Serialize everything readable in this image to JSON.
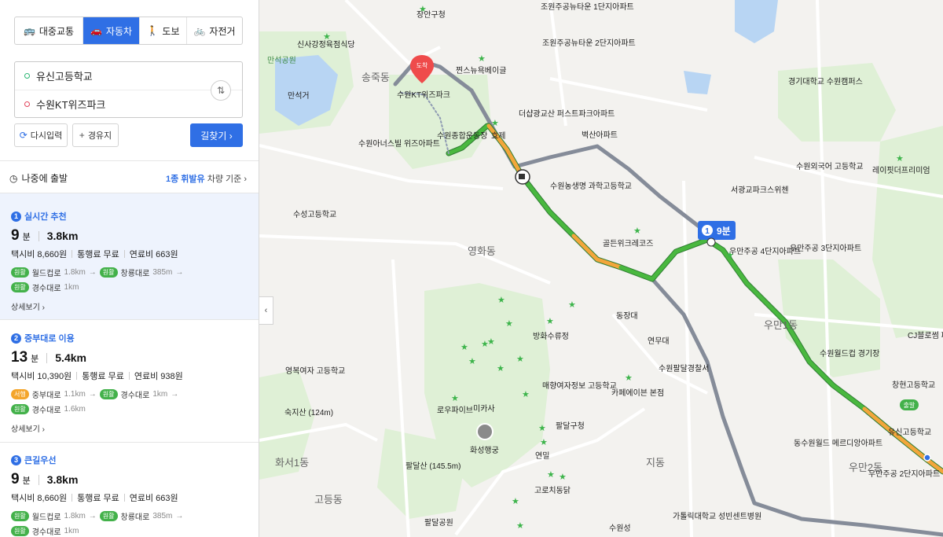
{
  "tabs": [
    {
      "label": "대중교통",
      "icon": "bus-icon",
      "glyph": "🚌",
      "active": false
    },
    {
      "label": "자동차",
      "icon": "car-icon",
      "glyph": "🚗",
      "active": true
    },
    {
      "label": "도보",
      "icon": "walk-icon",
      "glyph": "🚶",
      "active": false
    },
    {
      "label": "자전거",
      "icon": "bicycle-icon",
      "glyph": "🚲",
      "active": false
    }
  ],
  "route": {
    "origin": "유신고등학교",
    "destination": "수원KT위즈파크",
    "swap_glyph": "⇅"
  },
  "buttons": {
    "reset": "다시입력",
    "waypoint": "경유지",
    "search": "길찾기 ›"
  },
  "depart": {
    "label": "나중에 출발",
    "fuel_highlight": "1종 휘발유",
    "fuel_suffix": "차량 기준 ›"
  },
  "routes": [
    {
      "num": "1",
      "title": "실시간 추천",
      "time": "9",
      "time_unit": "분",
      "distance": "3.8km",
      "taxi": "택시비 8,660원",
      "toll": "통행료 무료",
      "fuel": "연료비 663원",
      "roads_line1": [
        {
          "badge": "원활",
          "name": "월드컵로",
          "dist": "1.8km"
        },
        {
          "badge": "원활",
          "name": "창룡대로",
          "dist": "385m"
        }
      ],
      "roads_line2": [
        {
          "badge": "원활",
          "name": "경수대로",
          "dist": "1km"
        }
      ],
      "detail": "상세보기 ›"
    },
    {
      "num": "2",
      "title": "중부대로 이용",
      "time": "13",
      "time_unit": "분",
      "distance": "5.4km",
      "taxi": "택시비 10,390원",
      "toll": "통행료 무료",
      "fuel": "연료비 938원",
      "roads_line1": [
        {
          "badge": "서행",
          "name": "중부대로",
          "dist": "1.1km"
        },
        {
          "badge": "원활",
          "name": "경수대로",
          "dist": "1km"
        }
      ],
      "roads_line2": [
        {
          "badge": "원활",
          "name": "경수대로",
          "dist": "1.6km"
        }
      ],
      "detail": "상세보기 ›"
    },
    {
      "num": "3",
      "title": "큰길우선",
      "time": "9",
      "time_unit": "분",
      "distance": "3.8km",
      "taxi": "택시비 8,660원",
      "toll": "통행료 무료",
      "fuel": "연료비 663원",
      "roads_line1": [
        {
          "badge": "원활",
          "name": "월드컵로",
          "dist": "1.8km"
        },
        {
          "badge": "원활",
          "name": "창룡대로",
          "dist": "385m"
        }
      ],
      "roads_line2": [
        {
          "badge": "원활",
          "name": "경수대로",
          "dist": "1km"
        }
      ]
    }
  ],
  "map": {
    "route_badge_num": "1",
    "route_badge_time": "9분",
    "start_label": "출발",
    "end_label": "도착",
    "areas": [
      "송죽동",
      "영화동",
      "우만1동",
      "우만2동",
      "화서1동",
      "고등동",
      "지동"
    ],
    "pois": [
      "장안구청",
      "조원주공뉴타운 1단지아파트",
      "신사강정육점식당",
      "조원주공뉴타운 2단지아파트",
      "만석공원",
      "만석거",
      "찐스뉴욕베이글",
      "수원KT위즈파크",
      "더샵광교산 퍼스트파크아파트",
      "경기대학교 수원캠퍼스",
      "수원종합운동장",
      "효제",
      "수원아너스빌 위즈아파트",
      "벽산아파트",
      "수원외국어 고등학교",
      "레이핏더프리미엄",
      "수원농생명 과학고등학교",
      "서광교파크스위첸",
      "수성고등학교",
      "골든위크레코즈",
      "우만주공 4단지아파트",
      "우만주공 3단지아파트",
      "동장대",
      "방화수류정",
      "연무대",
      "수원월드컵 경기장",
      "CJ블로썸 파크",
      "영복여자 고등학교",
      "매향여자정보 고등학교",
      "수원팔달경찰서",
      "카페에이븐 본점",
      "창현고등학교",
      "숙지산 (124m)",
      "로우파이브",
      "미카사",
      "팔달구청",
      "유신고등학교",
      "화성행궁",
      "연밀",
      "동수원월드 메르디앙아파트",
      "팔달산 (145.5m)",
      "고로치동닭",
      "우만주공 2단지아파트",
      "가톨릭대학교 성빈센트병원",
      "팔달공원",
      "수원성"
    ]
  }
}
